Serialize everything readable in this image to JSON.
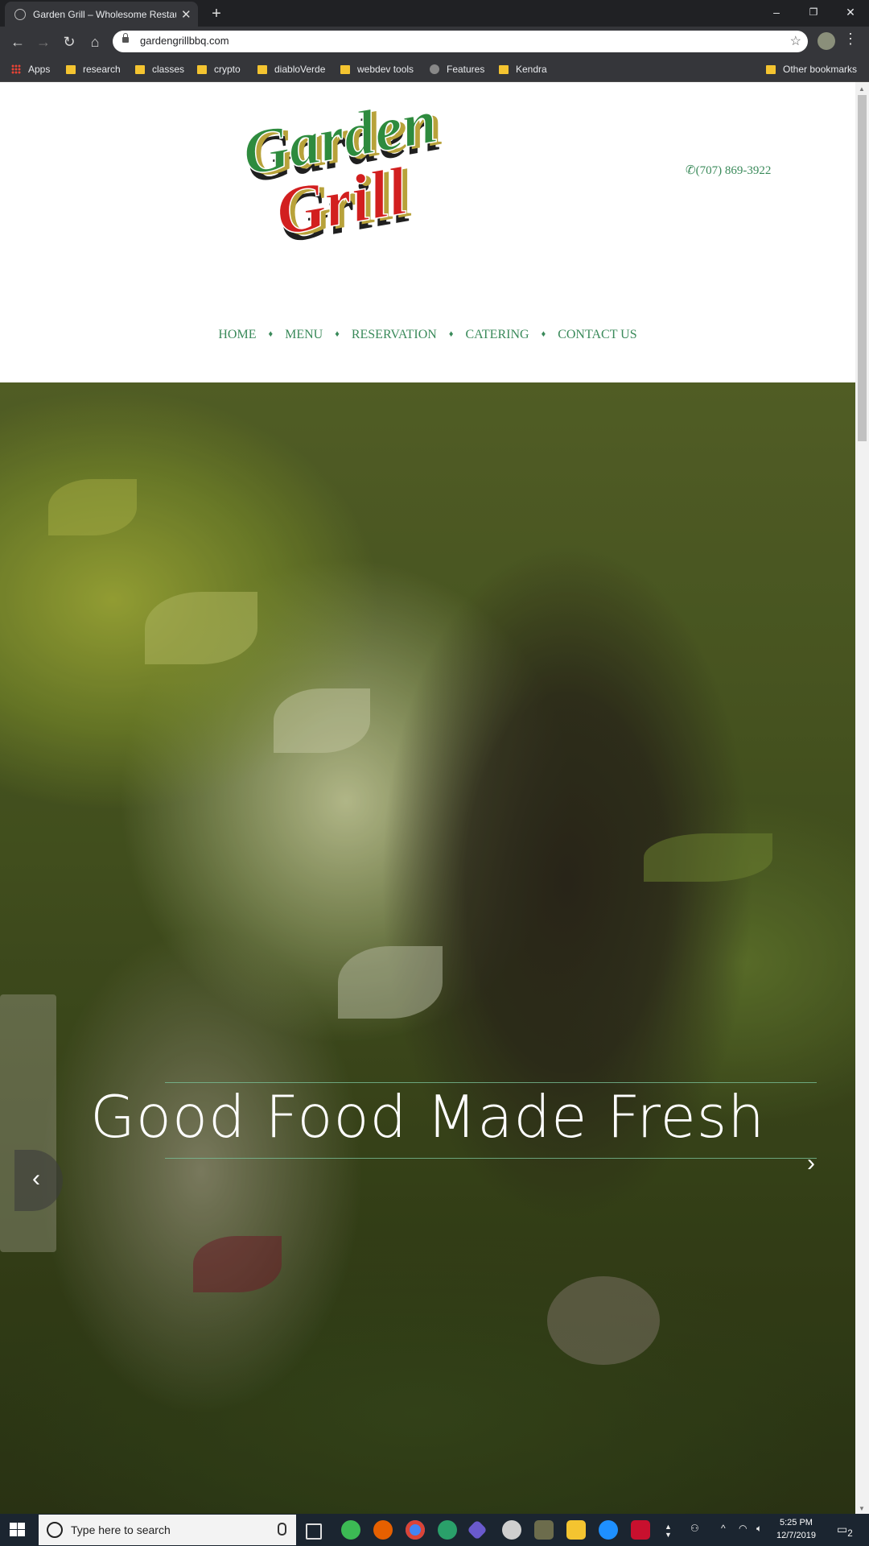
{
  "browser": {
    "tab_title": "Garden Grill – Wholesome Restau",
    "new_tab_label": "+",
    "url": "gardengrillbbq.com",
    "window_controls": [
      "–",
      "❐",
      "✕"
    ]
  },
  "bookmarks": {
    "items": [
      "Apps",
      "research",
      "classes",
      "crypto",
      "diabloVerde",
      "webdev tools",
      "Features",
      "Kendra"
    ],
    "other": "Other bookmarks"
  },
  "site": {
    "logo_text_top": "Garden",
    "logo_text_bottom": "Grill",
    "phone": "(707) 869-3922",
    "nav": [
      "HOME",
      "MENU",
      "RESERVATION",
      "CATERING",
      "CONTACT US"
    ],
    "nav_separator": "♦",
    "hero_title": "Good Food Made Fresh",
    "prev_label": "‹",
    "next_label": "›"
  },
  "taskbar": {
    "search_placeholder": "Type here to search",
    "time": "5:25 PM",
    "date": "12/7/2019",
    "notifications": "2"
  },
  "colors": {
    "brand_green": "#3a8a5a",
    "logo_green": "#2e8b3e",
    "logo_red": "#d21f1f",
    "logo_gold": "#b8a23a"
  }
}
